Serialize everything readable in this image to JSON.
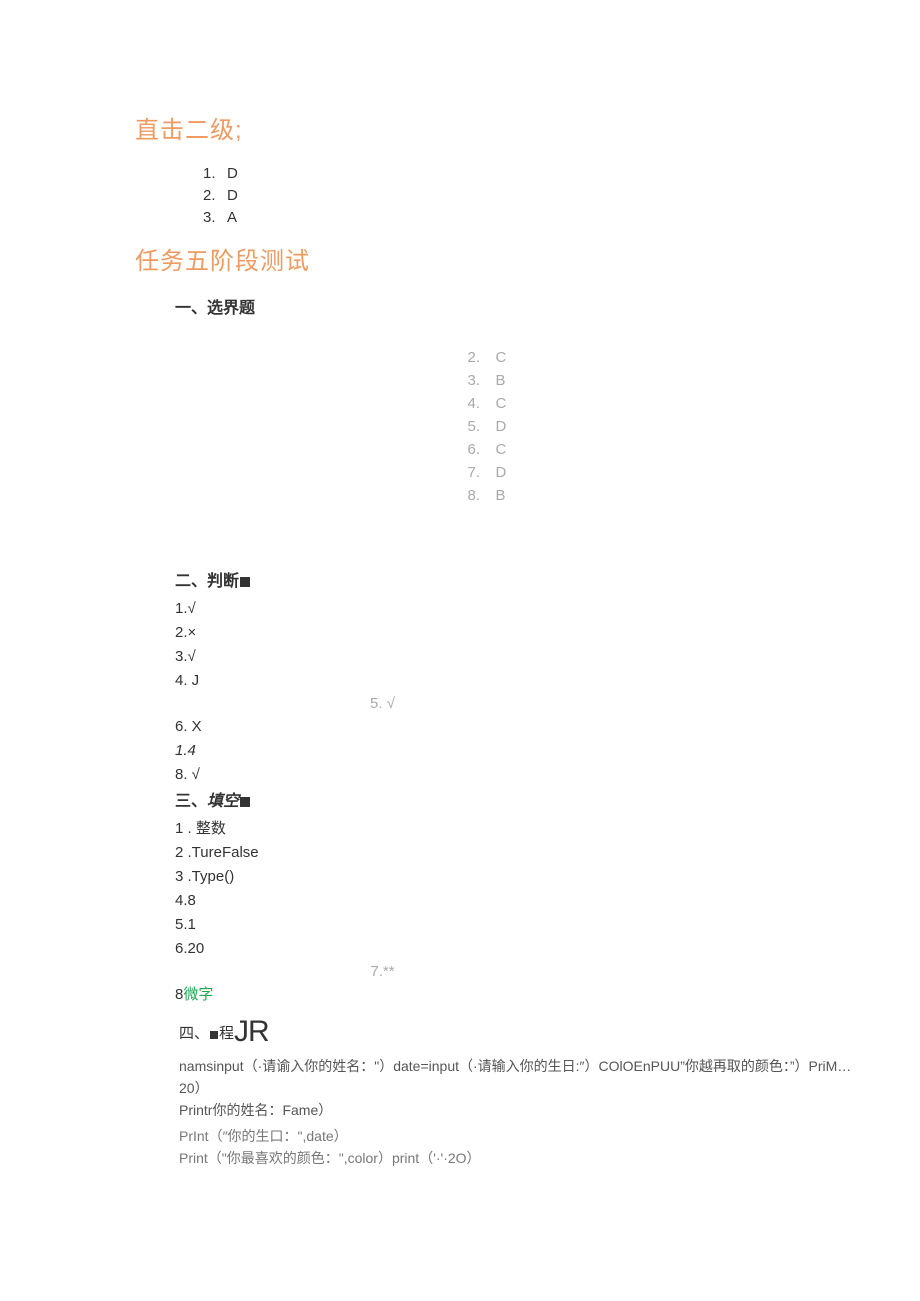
{
  "section1": {
    "title": "直击二级;",
    "items": [
      {
        "n": "1.",
        "v": "D"
      },
      {
        "n": "2.",
        "v": "D"
      },
      {
        "n": "3.",
        "v": "A"
      }
    ]
  },
  "section2": {
    "title": "任务五阶段测试",
    "part1": {
      "label": "一、选界题",
      "answers": [
        {
          "n": "2.",
          "v": "C"
        },
        {
          "n": "3.",
          "v": "B"
        },
        {
          "n": "4.",
          "v": "C"
        },
        {
          "n": "5.",
          "v": "D"
        },
        {
          "n": "6.",
          "v": "C"
        },
        {
          "n": "7.",
          "v": "D"
        },
        {
          "n": "8.",
          "v": "B"
        }
      ]
    },
    "part2": {
      "label_prefix": "二、判断",
      "lines": {
        "l1": "1.√",
        "l2": "2.×",
        "l3": "3.√",
        "l4": "4.   J",
        "l5": "5. √",
        "l6": "6.   X",
        "l7": "1.4",
        "l8": "8.   √"
      }
    },
    "part3": {
      "label_prefix": "三、",
      "label_bold": "填空",
      "lines": {
        "l1": "1   . 整数",
        "l2": "2   .TureFalse",
        "l3": "3   .Type()",
        "l4": "4.8",
        "l5": "5.1",
        "l6": "6.20",
        "l7": "7.**",
        "l8a": "8",
        "l8b": "微字"
      }
    },
    "part4": {
      "label_prefix": "四、",
      "label_mid": "程",
      "label_big": "JR",
      "body": {
        "p1": "namsinput（·请谕入你的姓名：\"）date=input（·请输入你的生日:″）COlOEnPUU”你越再取的颜色：”）PriM…20）",
        "p2": "Printr你的姓名：Fame）",
        "p3": "PrInt（″你的生口：\",date）",
        "p4": "Print（\"你最喜欢的颜色：\",color）print（'·'·2O）"
      }
    }
  }
}
